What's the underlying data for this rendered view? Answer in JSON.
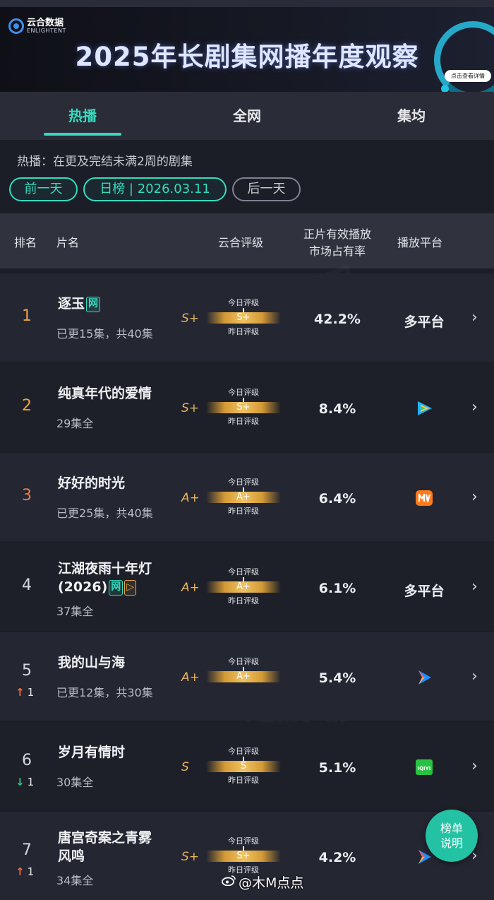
{
  "banner": {
    "logo_cn": "云合数据",
    "logo_en": "ENLIGHTENT",
    "title": "2025年长剧集网播年度观察",
    "detail_button": "点击查看详情"
  },
  "tabs": [
    {
      "label": "热播",
      "active": true
    },
    {
      "label": "全网",
      "active": false
    },
    {
      "label": "集均",
      "active": false
    }
  ],
  "note": "热播：在更及完结未满2周的剧集",
  "date_nav": {
    "prev": "前一天",
    "current": "日榜 | 2026.03.11",
    "next": "后一天"
  },
  "table_headers": {
    "rank": "排名",
    "name": "片名",
    "rating": "云合评级",
    "share_line1": "正片有效播放",
    "share_line2": "市场占有率",
    "platform": "播放平台"
  },
  "gauge_labels": {
    "today": "今日评级",
    "yesterday": "昨日评级"
  },
  "rows": [
    {
      "rank": "1",
      "title": "逐玉",
      "title2": "",
      "tags": [
        "网"
      ],
      "subtitle": "已更15集，共40集",
      "grade": "S+",
      "grade_today": "S+",
      "share": "42.2%",
      "platform": "多平台",
      "platform_icon": "",
      "move": "",
      "move_dir": ""
    },
    {
      "rank": "2",
      "title": "纯真年代的爱情",
      "title2": "",
      "tags": [],
      "subtitle": "29集全",
      "grade": "S+",
      "grade_today": "S+",
      "share": "8.4%",
      "platform": "",
      "platform_icon": "tencent-video-icon",
      "move": "",
      "move_dir": ""
    },
    {
      "rank": "3",
      "title": "好好的时光",
      "title2": "",
      "tags": [],
      "subtitle": "已更25集，共40集",
      "grade": "A+",
      "grade_today": "A+",
      "share": "6.4%",
      "platform": "",
      "platform_icon": "mango-tv-icon",
      "move": "",
      "move_dir": ""
    },
    {
      "rank": "4",
      "title": "江湖夜雨十年灯",
      "title2": "(2026)",
      "tags": [
        "网"
      ],
      "subtitle": "37集全",
      "grade": "A+",
      "grade_today": "A+",
      "share": "6.1%",
      "platform": "多平台",
      "platform_icon": "",
      "move": "",
      "move_dir": ""
    },
    {
      "rank": "5",
      "title": "我的山与海",
      "title2": "",
      "tags": [],
      "subtitle": "已更12集，共30集",
      "grade": "A+",
      "grade_today": "A+",
      "share": "5.4%",
      "platform": "",
      "platform_icon": "youku-icon",
      "move": "1",
      "move_dir": "up"
    },
    {
      "rank": "6",
      "title": "岁月有情时",
      "title2": "",
      "tags": [],
      "subtitle": "30集全",
      "grade": "S",
      "grade_today": "S",
      "share": "5.1%",
      "platform": "",
      "platform_icon": "iqiyi-icon",
      "move": "1",
      "move_dir": "down"
    },
    {
      "rank": "7",
      "title": "唐宫奇案之青雾",
      "title2": "风鸣",
      "tags": [],
      "subtitle": "34集全",
      "grade": "S+",
      "grade_today": "S+",
      "share": "4.2%",
      "platform": "",
      "platform_icon": "youku-icon",
      "move": "1",
      "move_dir": "up"
    }
  ],
  "iqiyi_text": "iQIYI",
  "help_button": {
    "line1": "榜单",
    "line2": "说明"
  },
  "watermark": {
    "text": "@木M点点"
  },
  "colors": {
    "accent": "#33dcc0",
    "gold": "#e9b45b",
    "up": "#ff6a3c",
    "down": "#2fc882"
  }
}
